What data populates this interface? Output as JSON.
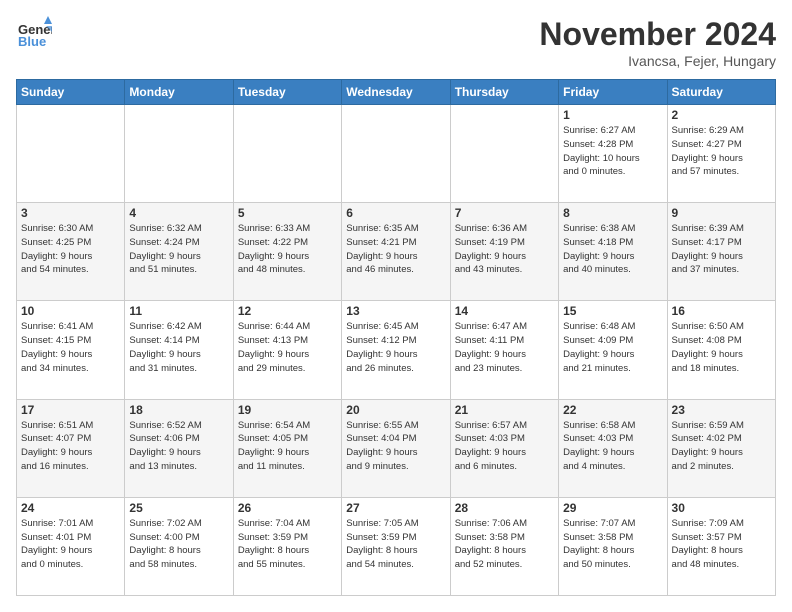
{
  "logo": {
    "line1": "General",
    "line2": "Blue"
  },
  "title": "November 2024",
  "location": "Ivancsa, Fejer, Hungary",
  "days_header": [
    "Sunday",
    "Monday",
    "Tuesday",
    "Wednesday",
    "Thursday",
    "Friday",
    "Saturday"
  ],
  "weeks": [
    [
      {
        "day": "",
        "info": ""
      },
      {
        "day": "",
        "info": ""
      },
      {
        "day": "",
        "info": ""
      },
      {
        "day": "",
        "info": ""
      },
      {
        "day": "",
        "info": ""
      },
      {
        "day": "1",
        "info": "Sunrise: 6:27 AM\nSunset: 4:28 PM\nDaylight: 10 hours\nand 0 minutes."
      },
      {
        "day": "2",
        "info": "Sunrise: 6:29 AM\nSunset: 4:27 PM\nDaylight: 9 hours\nand 57 minutes."
      }
    ],
    [
      {
        "day": "3",
        "info": "Sunrise: 6:30 AM\nSunset: 4:25 PM\nDaylight: 9 hours\nand 54 minutes."
      },
      {
        "day": "4",
        "info": "Sunrise: 6:32 AM\nSunset: 4:24 PM\nDaylight: 9 hours\nand 51 minutes."
      },
      {
        "day": "5",
        "info": "Sunrise: 6:33 AM\nSunset: 4:22 PM\nDaylight: 9 hours\nand 48 minutes."
      },
      {
        "day": "6",
        "info": "Sunrise: 6:35 AM\nSunset: 4:21 PM\nDaylight: 9 hours\nand 46 minutes."
      },
      {
        "day": "7",
        "info": "Sunrise: 6:36 AM\nSunset: 4:19 PM\nDaylight: 9 hours\nand 43 minutes."
      },
      {
        "day": "8",
        "info": "Sunrise: 6:38 AM\nSunset: 4:18 PM\nDaylight: 9 hours\nand 40 minutes."
      },
      {
        "day": "9",
        "info": "Sunrise: 6:39 AM\nSunset: 4:17 PM\nDaylight: 9 hours\nand 37 minutes."
      }
    ],
    [
      {
        "day": "10",
        "info": "Sunrise: 6:41 AM\nSunset: 4:15 PM\nDaylight: 9 hours\nand 34 minutes."
      },
      {
        "day": "11",
        "info": "Sunrise: 6:42 AM\nSunset: 4:14 PM\nDaylight: 9 hours\nand 31 minutes."
      },
      {
        "day": "12",
        "info": "Sunrise: 6:44 AM\nSunset: 4:13 PM\nDaylight: 9 hours\nand 29 minutes."
      },
      {
        "day": "13",
        "info": "Sunrise: 6:45 AM\nSunset: 4:12 PM\nDaylight: 9 hours\nand 26 minutes."
      },
      {
        "day": "14",
        "info": "Sunrise: 6:47 AM\nSunset: 4:11 PM\nDaylight: 9 hours\nand 23 minutes."
      },
      {
        "day": "15",
        "info": "Sunrise: 6:48 AM\nSunset: 4:09 PM\nDaylight: 9 hours\nand 21 minutes."
      },
      {
        "day": "16",
        "info": "Sunrise: 6:50 AM\nSunset: 4:08 PM\nDaylight: 9 hours\nand 18 minutes."
      }
    ],
    [
      {
        "day": "17",
        "info": "Sunrise: 6:51 AM\nSunset: 4:07 PM\nDaylight: 9 hours\nand 16 minutes."
      },
      {
        "day": "18",
        "info": "Sunrise: 6:52 AM\nSunset: 4:06 PM\nDaylight: 9 hours\nand 13 minutes."
      },
      {
        "day": "19",
        "info": "Sunrise: 6:54 AM\nSunset: 4:05 PM\nDaylight: 9 hours\nand 11 minutes."
      },
      {
        "day": "20",
        "info": "Sunrise: 6:55 AM\nSunset: 4:04 PM\nDaylight: 9 hours\nand 9 minutes."
      },
      {
        "day": "21",
        "info": "Sunrise: 6:57 AM\nSunset: 4:03 PM\nDaylight: 9 hours\nand 6 minutes."
      },
      {
        "day": "22",
        "info": "Sunrise: 6:58 AM\nSunset: 4:03 PM\nDaylight: 9 hours\nand 4 minutes."
      },
      {
        "day": "23",
        "info": "Sunrise: 6:59 AM\nSunset: 4:02 PM\nDaylight: 9 hours\nand 2 minutes."
      }
    ],
    [
      {
        "day": "24",
        "info": "Sunrise: 7:01 AM\nSunset: 4:01 PM\nDaylight: 9 hours\nand 0 minutes."
      },
      {
        "day": "25",
        "info": "Sunrise: 7:02 AM\nSunset: 4:00 PM\nDaylight: 8 hours\nand 58 minutes."
      },
      {
        "day": "26",
        "info": "Sunrise: 7:04 AM\nSunset: 3:59 PM\nDaylight: 8 hours\nand 55 minutes."
      },
      {
        "day": "27",
        "info": "Sunrise: 7:05 AM\nSunset: 3:59 PM\nDaylight: 8 hours\nand 54 minutes."
      },
      {
        "day": "28",
        "info": "Sunrise: 7:06 AM\nSunset: 3:58 PM\nDaylight: 8 hours\nand 52 minutes."
      },
      {
        "day": "29",
        "info": "Sunrise: 7:07 AM\nSunset: 3:58 PM\nDaylight: 8 hours\nand 50 minutes."
      },
      {
        "day": "30",
        "info": "Sunrise: 7:09 AM\nSunset: 3:57 PM\nDaylight: 8 hours\nand 48 minutes."
      }
    ]
  ]
}
